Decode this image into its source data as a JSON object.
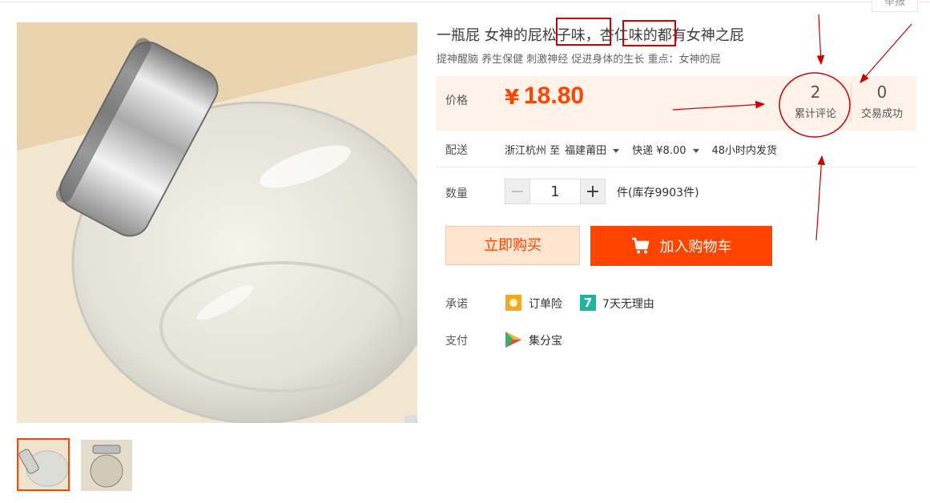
{
  "header": {
    "report_label": "举报"
  },
  "product": {
    "title_part1": "一瓶屁 女神的屁",
    "title_part2": "松子味",
    "title_sep": "，",
    "title_part3": "杏仁味",
    "title_part4": "的都有女神之屁",
    "subtitle": "提神醒脑 养生保健 刺激神经 促进身体的生长 重点：女神的屁"
  },
  "price": {
    "label": "价格",
    "currency": "¥",
    "value": "18.80",
    "reviews_count": "2",
    "reviews_label": "累计评论",
    "deals_count": "0",
    "deals_label": "交易成功"
  },
  "shipping": {
    "label": "配送",
    "from": "浙江杭州 至",
    "to": "福建莆田",
    "method": "快递 ¥8.00",
    "dispatch": "48小时内发货"
  },
  "quantity": {
    "label": "数量",
    "minus": "−",
    "value": "1",
    "plus": "+",
    "stock_text": "件(库存9903件)"
  },
  "actions": {
    "buy_now": "立即购买",
    "add_to_cart": "加入购物车"
  },
  "promise": {
    "label": "承诺",
    "item1": "订单险",
    "item2_badge": "7",
    "item2": "7天无理由"
  },
  "payment": {
    "label": "支付",
    "item1": "集分宝"
  },
  "icons": {
    "zoom": "magnifier-icon",
    "cart": "cart-icon",
    "insurance": "sun-badge-icon",
    "seven_days": "seven-day-badge-icon",
    "points": "jifenbao-icon"
  },
  "colors": {
    "accent": "#ff4400",
    "price_panel_bg": "#fff2e8",
    "buy_now_bg": "#ffe4d0",
    "annotation": "#cc0000"
  }
}
